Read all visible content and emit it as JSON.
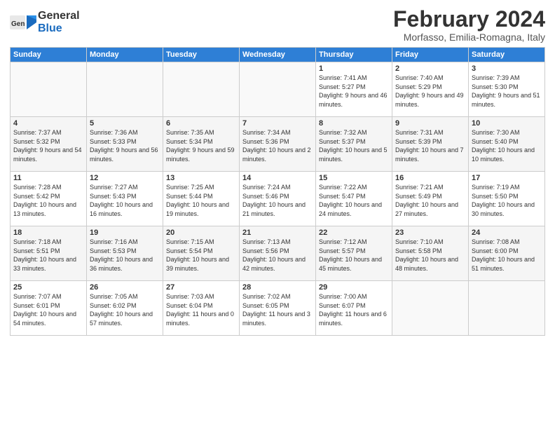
{
  "header": {
    "logo_general": "General",
    "logo_blue": "Blue",
    "month_title": "February 2024",
    "location": "Morfasso, Emilia-Romagna, Italy"
  },
  "weekdays": [
    "Sunday",
    "Monday",
    "Tuesday",
    "Wednesday",
    "Thursday",
    "Friday",
    "Saturday"
  ],
  "weeks": [
    [
      {
        "day": "",
        "sunrise": "",
        "sunset": "",
        "daylight": ""
      },
      {
        "day": "",
        "sunrise": "",
        "sunset": "",
        "daylight": ""
      },
      {
        "day": "",
        "sunrise": "",
        "sunset": "",
        "daylight": ""
      },
      {
        "day": "",
        "sunrise": "",
        "sunset": "",
        "daylight": ""
      },
      {
        "day": "1",
        "sunrise": "Sunrise: 7:41 AM",
        "sunset": "Sunset: 5:27 PM",
        "daylight": "Daylight: 9 hours and 46 minutes."
      },
      {
        "day": "2",
        "sunrise": "Sunrise: 7:40 AM",
        "sunset": "Sunset: 5:29 PM",
        "daylight": "Daylight: 9 hours and 49 minutes."
      },
      {
        "day": "3",
        "sunrise": "Sunrise: 7:39 AM",
        "sunset": "Sunset: 5:30 PM",
        "daylight": "Daylight: 9 hours and 51 minutes."
      }
    ],
    [
      {
        "day": "4",
        "sunrise": "Sunrise: 7:37 AM",
        "sunset": "Sunset: 5:32 PM",
        "daylight": "Daylight: 9 hours and 54 minutes."
      },
      {
        "day": "5",
        "sunrise": "Sunrise: 7:36 AM",
        "sunset": "Sunset: 5:33 PM",
        "daylight": "Daylight: 9 hours and 56 minutes."
      },
      {
        "day": "6",
        "sunrise": "Sunrise: 7:35 AM",
        "sunset": "Sunset: 5:34 PM",
        "daylight": "Daylight: 9 hours and 59 minutes."
      },
      {
        "day": "7",
        "sunrise": "Sunrise: 7:34 AM",
        "sunset": "Sunset: 5:36 PM",
        "daylight": "Daylight: 10 hours and 2 minutes."
      },
      {
        "day": "8",
        "sunrise": "Sunrise: 7:32 AM",
        "sunset": "Sunset: 5:37 PM",
        "daylight": "Daylight: 10 hours and 5 minutes."
      },
      {
        "day": "9",
        "sunrise": "Sunrise: 7:31 AM",
        "sunset": "Sunset: 5:39 PM",
        "daylight": "Daylight: 10 hours and 7 minutes."
      },
      {
        "day": "10",
        "sunrise": "Sunrise: 7:30 AM",
        "sunset": "Sunset: 5:40 PM",
        "daylight": "Daylight: 10 hours and 10 minutes."
      }
    ],
    [
      {
        "day": "11",
        "sunrise": "Sunrise: 7:28 AM",
        "sunset": "Sunset: 5:42 PM",
        "daylight": "Daylight: 10 hours and 13 minutes."
      },
      {
        "day": "12",
        "sunrise": "Sunrise: 7:27 AM",
        "sunset": "Sunset: 5:43 PM",
        "daylight": "Daylight: 10 hours and 16 minutes."
      },
      {
        "day": "13",
        "sunrise": "Sunrise: 7:25 AM",
        "sunset": "Sunset: 5:44 PM",
        "daylight": "Daylight: 10 hours and 19 minutes."
      },
      {
        "day": "14",
        "sunrise": "Sunrise: 7:24 AM",
        "sunset": "Sunset: 5:46 PM",
        "daylight": "Daylight: 10 hours and 21 minutes."
      },
      {
        "day": "15",
        "sunrise": "Sunrise: 7:22 AM",
        "sunset": "Sunset: 5:47 PM",
        "daylight": "Daylight: 10 hours and 24 minutes."
      },
      {
        "day": "16",
        "sunrise": "Sunrise: 7:21 AM",
        "sunset": "Sunset: 5:49 PM",
        "daylight": "Daylight: 10 hours and 27 minutes."
      },
      {
        "day": "17",
        "sunrise": "Sunrise: 7:19 AM",
        "sunset": "Sunset: 5:50 PM",
        "daylight": "Daylight: 10 hours and 30 minutes."
      }
    ],
    [
      {
        "day": "18",
        "sunrise": "Sunrise: 7:18 AM",
        "sunset": "Sunset: 5:51 PM",
        "daylight": "Daylight: 10 hours and 33 minutes."
      },
      {
        "day": "19",
        "sunrise": "Sunrise: 7:16 AM",
        "sunset": "Sunset: 5:53 PM",
        "daylight": "Daylight: 10 hours and 36 minutes."
      },
      {
        "day": "20",
        "sunrise": "Sunrise: 7:15 AM",
        "sunset": "Sunset: 5:54 PM",
        "daylight": "Daylight: 10 hours and 39 minutes."
      },
      {
        "day": "21",
        "sunrise": "Sunrise: 7:13 AM",
        "sunset": "Sunset: 5:56 PM",
        "daylight": "Daylight: 10 hours and 42 minutes."
      },
      {
        "day": "22",
        "sunrise": "Sunrise: 7:12 AM",
        "sunset": "Sunset: 5:57 PM",
        "daylight": "Daylight: 10 hours and 45 minutes."
      },
      {
        "day": "23",
        "sunrise": "Sunrise: 7:10 AM",
        "sunset": "Sunset: 5:58 PM",
        "daylight": "Daylight: 10 hours and 48 minutes."
      },
      {
        "day": "24",
        "sunrise": "Sunrise: 7:08 AM",
        "sunset": "Sunset: 6:00 PM",
        "daylight": "Daylight: 10 hours and 51 minutes."
      }
    ],
    [
      {
        "day": "25",
        "sunrise": "Sunrise: 7:07 AM",
        "sunset": "Sunset: 6:01 PM",
        "daylight": "Daylight: 10 hours and 54 minutes."
      },
      {
        "day": "26",
        "sunrise": "Sunrise: 7:05 AM",
        "sunset": "Sunset: 6:02 PM",
        "daylight": "Daylight: 10 hours and 57 minutes."
      },
      {
        "day": "27",
        "sunrise": "Sunrise: 7:03 AM",
        "sunset": "Sunset: 6:04 PM",
        "daylight": "Daylight: 11 hours and 0 minutes."
      },
      {
        "day": "28",
        "sunrise": "Sunrise: 7:02 AM",
        "sunset": "Sunset: 6:05 PM",
        "daylight": "Daylight: 11 hours and 3 minutes."
      },
      {
        "day": "29",
        "sunrise": "Sunrise: 7:00 AM",
        "sunset": "Sunset: 6:07 PM",
        "daylight": "Daylight: 11 hours and 6 minutes."
      },
      {
        "day": "",
        "sunrise": "",
        "sunset": "",
        "daylight": ""
      },
      {
        "day": "",
        "sunrise": "",
        "sunset": "",
        "daylight": ""
      }
    ]
  ]
}
